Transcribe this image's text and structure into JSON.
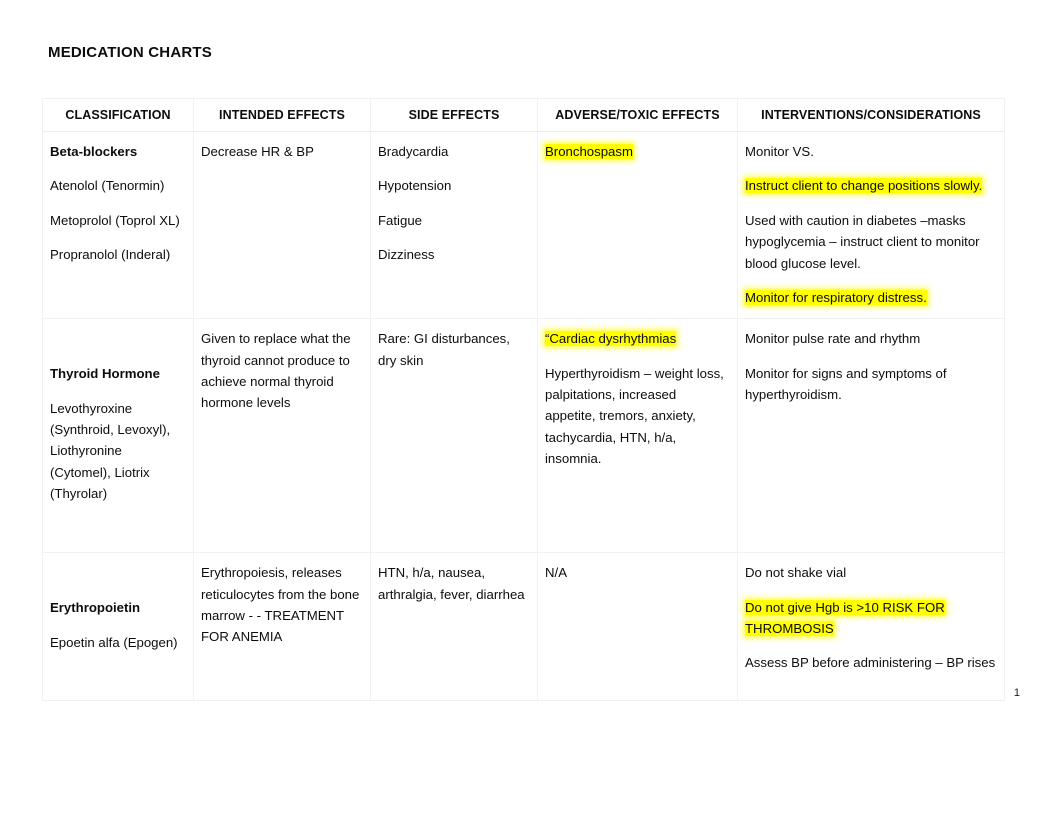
{
  "document": {
    "title": "MEDICATION CHARTS",
    "page_number": "1",
    "highlight_color": "#ffff00"
  },
  "table": {
    "headers": [
      "CLASSIFICATION",
      "INTENDED EFFECTS",
      "SIDE EFFECTS",
      "ADVERSE/TOXIC EFFECTS",
      "INTERVENTIONS/CONSIDERATIONS"
    ],
    "rows": [
      {
        "id": "beta-blockers",
        "classification": {
          "name": "Beta-blockers",
          "drugs": [
            "Atenolol (Tenormin)",
            "Metoprolol (Toprol XL)",
            "Propranolol (Inderal)"
          ]
        },
        "intended_effects": [
          "Decrease HR & BP"
        ],
        "side_effects": [
          "Bradycardia",
          "Hypotension",
          "Fatigue",
          "Dizziness"
        ],
        "adverse_toxic_effects": [
          "Bronchospasm"
        ],
        "interventions": [
          "Monitor VS.",
          "Instruct client to change positions slowly.",
          "Used with caution in diabetes –masks hypoglycemia – instruct client to monitor blood glucose level.",
          "Monitor for respiratory distress."
        ]
      },
      {
        "id": "thyroid-hormone",
        "classification": {
          "name": "Thyroid Hormone",
          "drugs": [
            "Levothyroxine (Synthroid, Levoxyl), Liothyronine (Cytomel), Liotrix (Thyrolar)"
          ]
        },
        "intended_effects": [
          "Given to replace what the thyroid cannot produce to achieve normal thyroid hormone levels"
        ],
        "side_effects": [
          "Rare: GI disturbances, dry skin"
        ],
        "adverse_toxic_effects": [
          "“Cardiac dysrhythmias",
          "Hyperthyroidism – weight loss, palpitations, increased appetite, tremors, anxiety, tachycardia, HTN, h/a, insomnia."
        ],
        "interventions": [
          "Monitor pulse rate and rhythm",
          "Monitor for signs and symptoms of hyperthyroidism."
        ]
      },
      {
        "id": "erythropoietin",
        "classification": {
          "name": "Erythropoietin",
          "drugs": [
            "Epoetin alfa (Epogen)"
          ]
        },
        "intended_effects": [
          "Erythropoiesis, releases reticulocytes from the bone marrow - - TREATMENT FOR ANEMIA"
        ],
        "side_effects": [
          "HTN, h/a, nausea, arthralgia, fever, diarrhea"
        ],
        "adverse_toxic_effects": [
          "N/A"
        ],
        "interventions": [
          "Do not shake vial",
          "Do not give Hgb is >10 RISK FOR THROMBOSIS",
          "Assess BP before administering – BP rises"
        ]
      }
    ]
  }
}
